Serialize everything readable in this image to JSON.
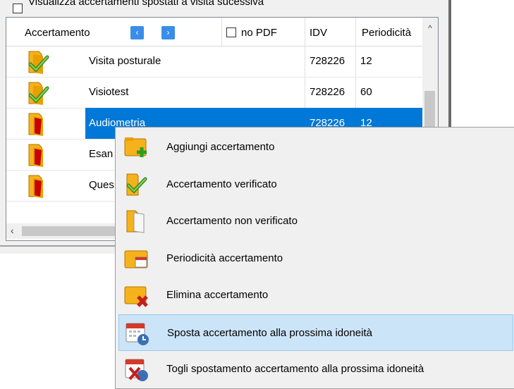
{
  "panel": {
    "checkbox_label": "Visualizza accertamenti spostati a visita sucessiva"
  },
  "grid": {
    "headers": {
      "accertamento": "Accertamento",
      "no_pdf": "no PDF",
      "idv": "IDV",
      "periodicita": "Periodicità"
    },
    "nav": {
      "prev": "‹",
      "next": "›"
    },
    "rows": [
      {
        "name": "Visita posturale",
        "idv": "728226",
        "periodicita": "12",
        "status": "verified"
      },
      {
        "name": "Visiotest",
        "idv": "728226",
        "periodicita": "60",
        "status": "verified"
      },
      {
        "name": "Audiometria",
        "idv": "728226",
        "periodicita": "12",
        "status": "not-verified",
        "selected": true
      },
      {
        "name": "Esan",
        "idv": "",
        "periodicita": "",
        "status": "not-verified"
      },
      {
        "name": "Ques",
        "idv": "",
        "periodicita": "",
        "status": "not-verified"
      }
    ]
  },
  "context_menu": {
    "items": [
      {
        "label": "Aggiungi accertamento",
        "icon": "folder-add-icon"
      },
      {
        "label": "Accertamento verificato",
        "icon": "folder-check-icon"
      },
      {
        "label": "Accertamento non verificato",
        "icon": "folder-open-icon"
      },
      {
        "label": "Periodicità accertamento",
        "icon": "folder-calendar-icon"
      },
      {
        "label": "Elimina accertamento",
        "icon": "folder-delete-icon"
      },
      {
        "label": "Sposta accertamento alla prossima idoneità",
        "icon": "calendar-clock-icon",
        "highlighted": true
      },
      {
        "label": "Togli spostamento accertamento alla prossima idoneità",
        "icon": "calendar-remove-icon"
      }
    ]
  },
  "colors": {
    "selection": "#0078d7",
    "menu_highlight": "#cce4f7",
    "nav_button": "#3a8ee8"
  }
}
